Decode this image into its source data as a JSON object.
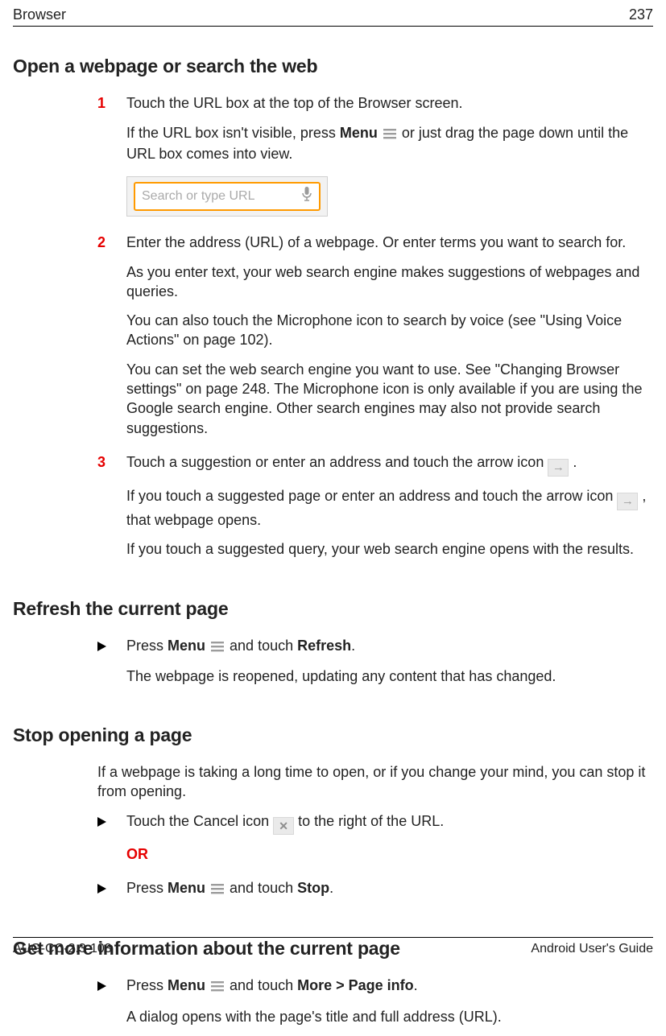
{
  "header": {
    "left": "Browser",
    "right": "237"
  },
  "footer": {
    "left": "AUG-CC-2.3-103",
    "right": "Android User's Guide"
  },
  "s1": {
    "title": "Open a webpage or search the web",
    "step1": {
      "num": "1",
      "p1a": "Touch the URL box at the top of the Browser screen.",
      "p2a": "If the URL box isn't visible, press ",
      "p2menu": "Menu",
      "p2b": " or just drag the page down until the URL box comes into view.",
      "url_placeholder": "Search or type URL"
    },
    "step2": {
      "num": "2",
      "p1": "Enter the address (URL) of a webpage. Or enter terms you want to search for.",
      "p2": "As you enter text, your web search engine makes suggestions of webpages and queries.",
      "p3": "You can also touch the Microphone icon to search by voice (see \"Using Voice Actions\" on page 102).",
      "p4": "You can set the web search engine you want to use. See \"Changing Browser settings\" on page 248. The Microphone icon is only available if you are using the Google search engine. Other search engines may also not provide search suggestions."
    },
    "step3": {
      "num": "3",
      "p1a": "Touch a suggestion or enter an address and touch the arrow icon ",
      "p1b": " .",
      "p2a": "If you touch a suggested page or enter an address and touch the arrow icon ",
      "p2b": " , that webpage opens.",
      "p3": "If you touch a suggested query, your web search engine opens with the results."
    }
  },
  "s2": {
    "title": "Refresh the current page",
    "b1": {
      "pre": "Press ",
      "menu": "Menu",
      "mid": " and touch ",
      "refresh": "Refresh",
      "post": "."
    },
    "p2": "The webpage is reopened, updating any content that has changed."
  },
  "s3": {
    "title": "Stop opening a page",
    "intro": "If a webpage is taking a long time to open, or if you change your mind, you can stop it from opening.",
    "b1": {
      "pre": "Touch the Cancel icon ",
      "post": " to the right of the URL."
    },
    "or": "OR",
    "b2": {
      "pre": "Press ",
      "menu": "Menu",
      "mid": " and touch ",
      "stop": "Stop",
      "post": "."
    }
  },
  "s4": {
    "title": "Get more information about the current page",
    "b1": {
      "pre": "Press ",
      "menu": "Menu",
      "mid": " and touch ",
      "more": "More > Page info",
      "post": "."
    },
    "p2": "A dialog opens with the page's title and full address (URL)."
  },
  "icons": {
    "arrow_glyph": "→",
    "cancel_glyph": "✕"
  }
}
